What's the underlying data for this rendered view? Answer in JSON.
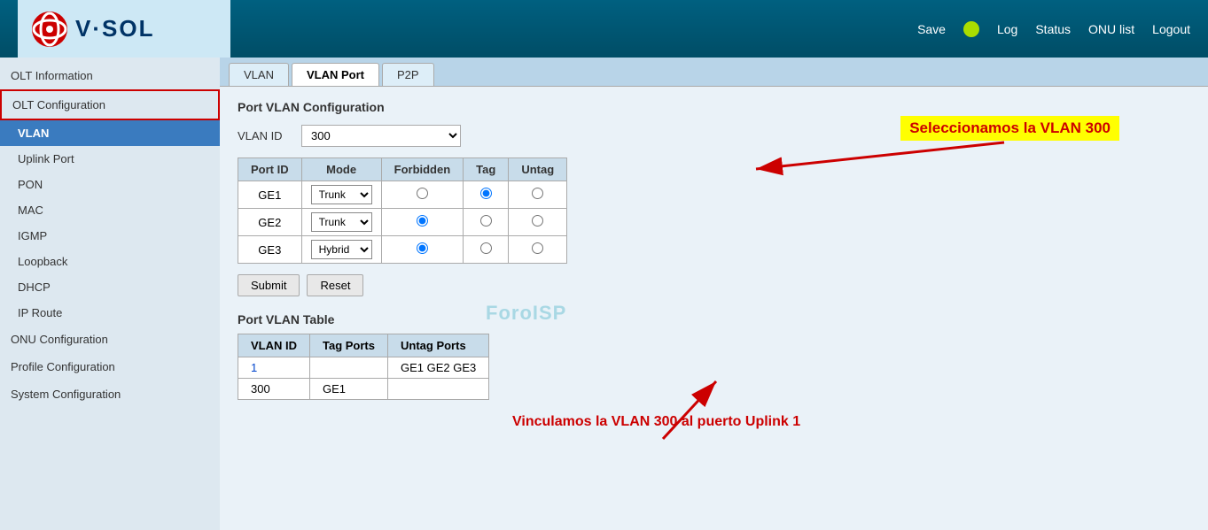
{
  "header": {
    "logo_text": "V·SOL",
    "save_label": "Save",
    "log_label": "Log",
    "status_label": "Status",
    "onu_list_label": "ONU list",
    "logout_label": "Logout"
  },
  "sidebar": {
    "olt_info": "OLT Information",
    "olt_config": "OLT Configuration",
    "items_olt": [
      {
        "label": "VLAN",
        "active": true
      },
      {
        "label": "Uplink Port",
        "active": false
      },
      {
        "label": "PON",
        "active": false
      },
      {
        "label": "MAC",
        "active": false
      },
      {
        "label": "IGMP",
        "active": false
      },
      {
        "label": "Loopback",
        "active": false
      },
      {
        "label": "DHCP",
        "active": false
      },
      {
        "label": "IP Route",
        "active": false
      }
    ],
    "onu_config": "ONU Configuration",
    "profile_config": "Profile Configuration",
    "system_config": "System Configuration"
  },
  "tabs": [
    {
      "label": "VLAN",
      "active": false
    },
    {
      "label": "VLAN Port",
      "active": true
    },
    {
      "label": "P2P",
      "active": false
    }
  ],
  "content": {
    "section_title": "Port VLAN Configuration",
    "vlan_id_label": "VLAN ID",
    "vlan_id_value": "300",
    "table_headers": [
      "Port ID",
      "Mode",
      "Forbidden",
      "Tag",
      "Untag"
    ],
    "rows": [
      {
        "port": "GE1",
        "mode": "Trunk",
        "forbidden": false,
        "tag": true,
        "untag": false
      },
      {
        "port": "GE2",
        "mode": "Trunk",
        "forbidden": true,
        "tag": false,
        "untag": false
      },
      {
        "port": "GE3",
        "mode": "Hybrid",
        "forbidden": true,
        "tag": false,
        "untag": false
      }
    ],
    "submit_label": "Submit",
    "reset_label": "Reset",
    "vlan_table_title": "Port VLAN Table",
    "vlan_table_headers": [
      "VLAN ID",
      "Tag Ports",
      "Untag Ports"
    ],
    "vlan_table_rows": [
      {
        "vlan_id": "1",
        "tag_ports": "",
        "untag_ports": "GE1 GE2 GE3"
      },
      {
        "vlan_id": "300",
        "tag_ports": "GE1",
        "untag_ports": ""
      }
    ]
  },
  "annotations": {
    "text1": "Seleccionamos la VLAN 300",
    "text2": "Vinculamos la VLAN 300 al puerto Uplink 1"
  }
}
